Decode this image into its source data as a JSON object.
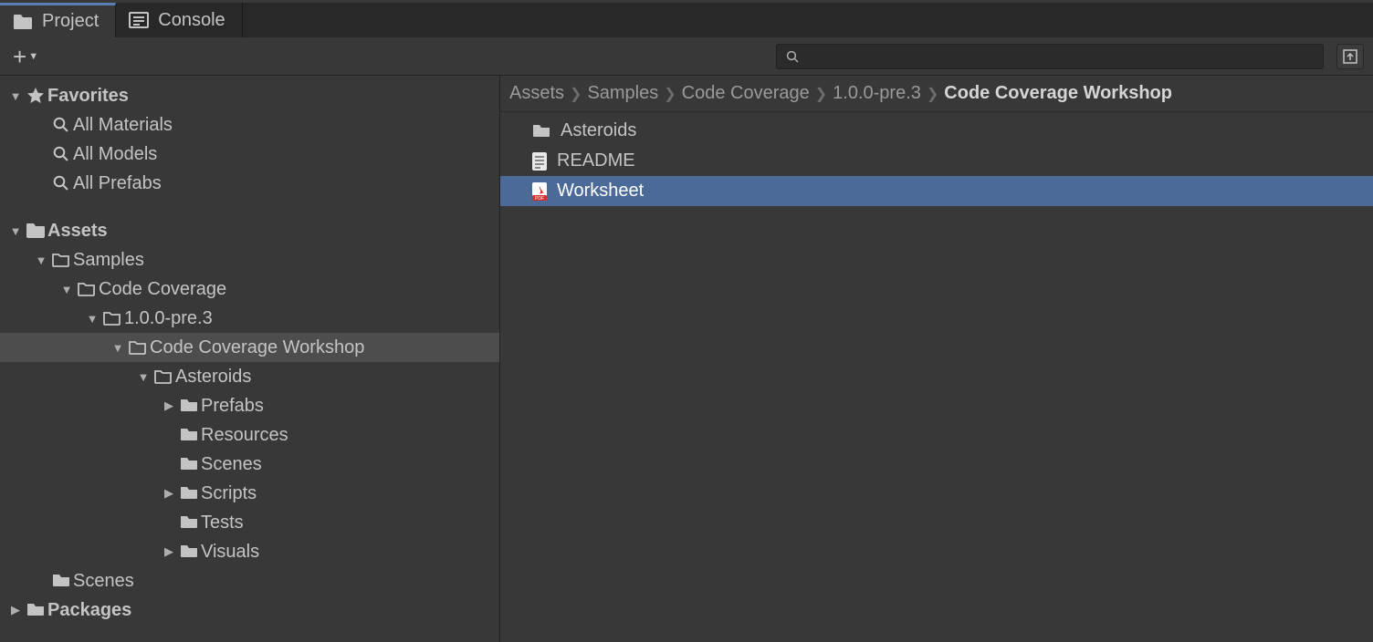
{
  "tabs": {
    "project": "Project",
    "console": "Console"
  },
  "search": {
    "placeholder": ""
  },
  "tree": {
    "favorites": "Favorites",
    "all_materials": "All Materials",
    "all_models": "All Models",
    "all_prefabs": "All Prefabs",
    "assets": "Assets",
    "samples": "Samples",
    "code_coverage": "Code Coverage",
    "version": "1.0.0-pre.3",
    "workshop": "Code Coverage Workshop",
    "asteroids": "Asteroids",
    "prefabs": "Prefabs",
    "resources": "Resources",
    "scenes": "Scenes",
    "scripts": "Scripts",
    "tests": "Tests",
    "visuals": "Visuals",
    "scenes2": "Scenes",
    "packages": "Packages"
  },
  "breadcrumb": {
    "a": "Assets",
    "b": "Samples",
    "c": "Code Coverage",
    "d": "1.0.0-pre.3",
    "e": "Code Coverage Workshop"
  },
  "files": {
    "asteroids": "Asteroids",
    "readme": "README",
    "worksheet": "Worksheet"
  }
}
